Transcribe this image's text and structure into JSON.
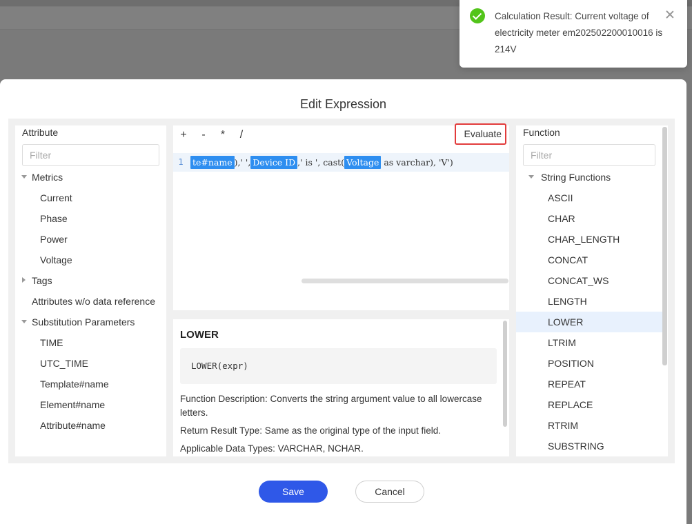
{
  "modal": {
    "title": "Edit Expression",
    "save_label": "Save",
    "cancel_label": "Cancel"
  },
  "attribute_panel": {
    "heading": "Attribute",
    "filter_placeholder": "Filter",
    "metrics": {
      "label": "Metrics",
      "items": [
        "Current",
        "Phase",
        "Power",
        "Voltage"
      ]
    },
    "tags": {
      "label": "Tags"
    },
    "no_ref": {
      "label": "Attributes w/o data reference"
    },
    "substitution": {
      "label": "Substitution Parameters",
      "items": [
        "TIME",
        "UTC_TIME",
        "Template#name",
        "Element#name",
        "Attribute#name"
      ]
    }
  },
  "editor": {
    "operators": [
      "+",
      "-",
      "*",
      "/"
    ],
    "evaluate_label": "Evaluate",
    "line_number": "1",
    "code": {
      "token_a": "te#name",
      "seg_1": "),' ',",
      "token_b": "Device ID",
      "seg_2": ",' is ', cast(",
      "token_c": "Voltage",
      "seg_3": " as varchar), 'V')"
    }
  },
  "description": {
    "title": "LOWER",
    "syntax": "LOWER(expr)",
    "function_description": "Function Description: Converts the string argument value to all lowercase letters.",
    "return_type": "Return Result Type: Same as the original type of the input field.",
    "data_types": "Applicable Data Types: VARCHAR, NCHAR."
  },
  "function_panel": {
    "heading": "Function",
    "filter_placeholder": "Filter",
    "group_label": "String Functions",
    "items": [
      "ASCII",
      "CHAR",
      "CHAR_LENGTH",
      "CONCAT",
      "CONCAT_WS",
      "LENGTH",
      "LOWER",
      "LTRIM",
      "POSITION",
      "REPEAT",
      "REPLACE",
      "RTRIM",
      "SUBSTRING"
    ],
    "selected": "LOWER"
  },
  "toast": {
    "message": "Calculation Result: Current voltage of electricity meter em202502200010016 is 214V",
    "status_color": "#52c41a",
    "icon": "check-circle-icon"
  },
  "colors": {
    "primary": "#2f58e8",
    "token": "#2e8ef0",
    "evaluate_highlight": "#e23b3b",
    "selected_row": "#e8f1fd"
  }
}
